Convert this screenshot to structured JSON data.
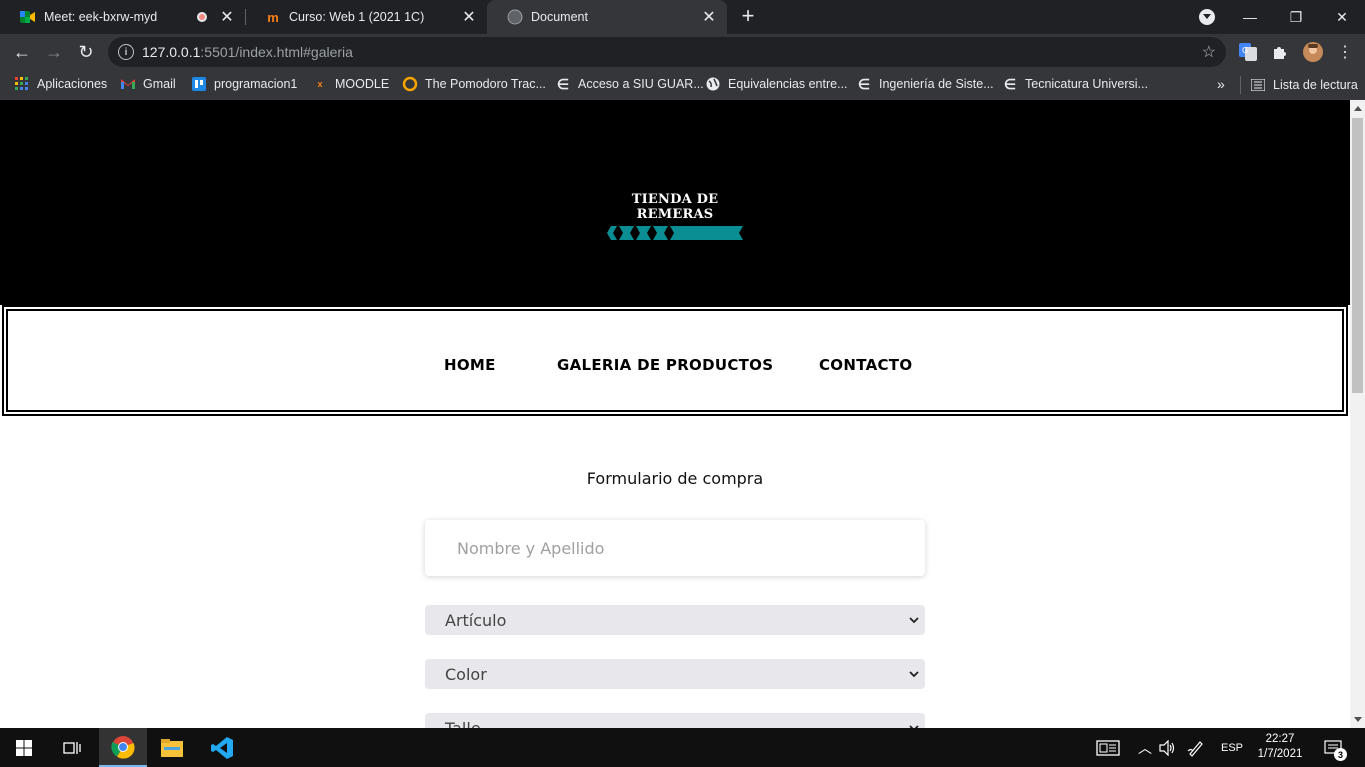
{
  "browser": {
    "tabs": [
      {
        "title": "Meet: eek-bxrw-myd",
        "icon": "google-meet-icon",
        "recording": true
      },
      {
        "title": "Curso: Web 1 (2021 1C)",
        "icon": "moodle-icon"
      },
      {
        "title": "Document",
        "icon": "globe-icon",
        "active": true
      }
    ],
    "url_host": "127.0.0.1",
    "url_rest": ":5501/index.html#galeria",
    "bookmarks": [
      {
        "label": "Aplicaciones",
        "icon": "apps-grid-icon"
      },
      {
        "label": "Gmail",
        "icon": "gmail-icon"
      },
      {
        "label": "programacion1",
        "icon": "trello-icon"
      },
      {
        "label": "MOODLE",
        "icon": "moodle-icon"
      },
      {
        "label": "The Pomodoro Trac...",
        "icon": "pomodoro-icon"
      },
      {
        "label": "Acceso a SIU GUAR...",
        "icon": "e-icon"
      },
      {
        "label": "Equivalencias entre...",
        "icon": "globe-icon"
      },
      {
        "label": "Ingeniería de Siste...",
        "icon": "e-icon"
      },
      {
        "label": "Tecnicatura Universi...",
        "icon": "e-icon"
      }
    ],
    "bookmarks_overflow": "»",
    "reading_list": "Lista de lectura"
  },
  "page": {
    "logo_text": "TIENDA DE REMERAS",
    "nav": [
      "HOME",
      "GALERIA DE PRODUCTOS",
      "CONTACTO"
    ],
    "form_title": "Formulario de compra",
    "name_placeholder": "Nombre y Apellido",
    "selects": [
      "Artículo",
      "Color",
      "Talle"
    ],
    "accent_color": "#0b8d94"
  },
  "taskbar": {
    "language": "ESP",
    "time": "22:27",
    "date": "1/7/2021",
    "notifications": "3"
  }
}
